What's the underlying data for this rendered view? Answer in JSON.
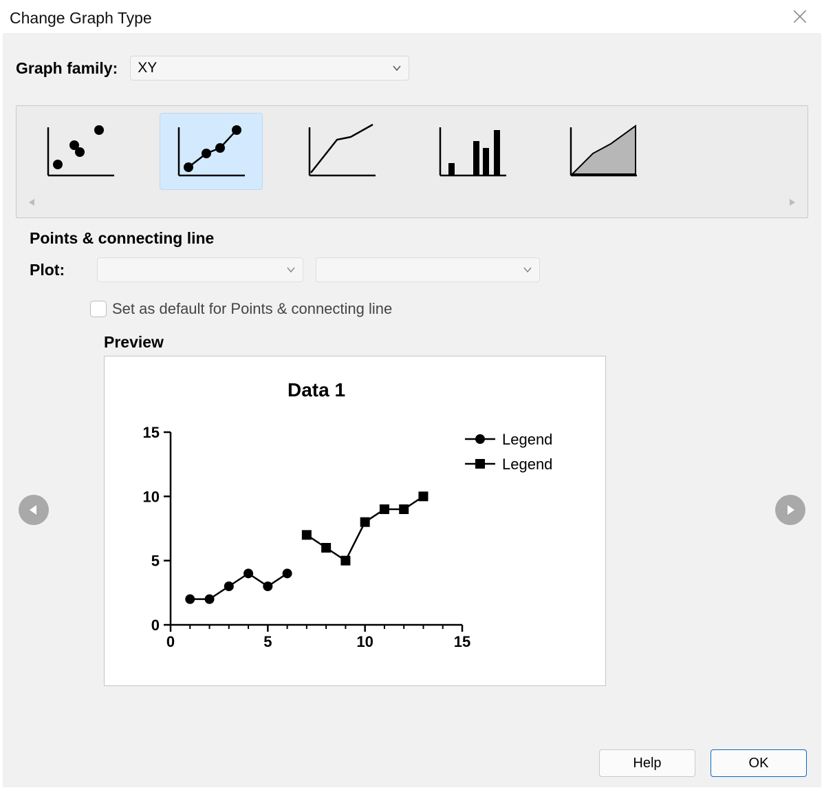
{
  "dialog": {
    "title": "Change Graph Type"
  },
  "family": {
    "label": "Graph family:",
    "value": "XY"
  },
  "type_strip": {
    "selected_index": 1,
    "types": [
      {
        "name": "scatter",
        "kind": "scatter"
      },
      {
        "name": "points-line",
        "kind": "pointsline"
      },
      {
        "name": "line-only",
        "kind": "line"
      },
      {
        "name": "spike-bars",
        "kind": "spikes"
      },
      {
        "name": "area",
        "kind": "area"
      }
    ]
  },
  "selected_type_label": "Points & connecting line",
  "plot": {
    "label": "Plot:"
  },
  "default_checkbox": {
    "label": "Set as default for Points & connecting line",
    "checked": false
  },
  "preview": {
    "section_label": "Preview",
    "title": "Data 1",
    "legend": [
      "Legend",
      "Legend"
    ]
  },
  "chart_data": {
    "type": "line",
    "title": "Data 1",
    "xlabel": "",
    "ylabel": "",
    "xlim": [
      0,
      15
    ],
    "ylim": [
      0,
      15
    ],
    "xticks": [
      0,
      5,
      10,
      15
    ],
    "yticks": [
      0,
      5,
      10,
      15
    ],
    "series": [
      {
        "name": "Legend",
        "marker": "circle",
        "x": [
          1,
          2,
          3,
          4,
          5,
          6
        ],
        "y": [
          2,
          2,
          3,
          4,
          3,
          4
        ]
      },
      {
        "name": "Legend",
        "marker": "square",
        "x": [
          7,
          8,
          9,
          10,
          11,
          12,
          13
        ],
        "y": [
          7,
          6,
          5,
          8,
          9,
          9,
          10
        ]
      }
    ]
  },
  "buttons": {
    "help": "Help",
    "ok": "OK"
  }
}
